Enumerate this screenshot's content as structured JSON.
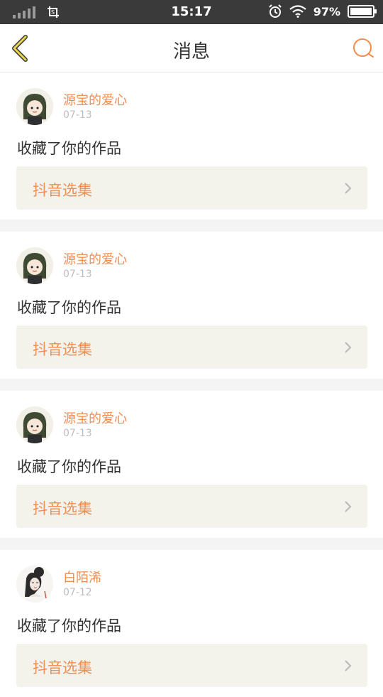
{
  "status_bar": {
    "time": "15:17",
    "battery": "97%",
    "icons": [
      "signal-icon",
      "screenshot-icon",
      "alarm-icon",
      "wifi-icon",
      "battery-icon"
    ]
  },
  "header": {
    "title": "消息",
    "back_icon": "chevron-left-icon",
    "search_icon": "search-icon",
    "accent_color": "#f08d4f"
  },
  "messages": [
    {
      "user": "源宝的爱心",
      "date": "07-13",
      "action": "收藏了你的作品",
      "work": "抖音选集",
      "avatar": "avatar-girl-green-hat"
    },
    {
      "user": "源宝的爱心",
      "date": "07-13",
      "action": "收藏了你的作品",
      "work": "抖音选集",
      "avatar": "avatar-girl-green-hat"
    },
    {
      "user": "源宝的爱心",
      "date": "07-13",
      "action": "收藏了你的作品",
      "work": "抖音选集",
      "avatar": "avatar-girl-green-hat"
    },
    {
      "user": "白陌浠",
      "date": "07-12",
      "action": "收藏了你的作品",
      "work": "抖音选集",
      "avatar": "avatar-girl-ink"
    }
  ]
}
